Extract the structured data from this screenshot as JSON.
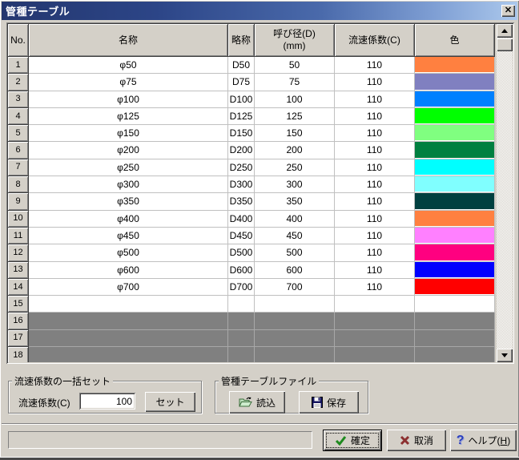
{
  "window": {
    "title": "管種テーブル"
  },
  "titlebar": {
    "gradient_left": "#24376f",
    "gradient_right": "#abc8ec"
  },
  "table": {
    "headers": {
      "no": "No.",
      "name": "名称",
      "abbr": "略称",
      "diameter_line1": "呼び径(D)",
      "diameter_line2": "(mm)",
      "coeff": "流速係数(C)",
      "color": "色"
    },
    "rows": [
      {
        "no": "1",
        "name": "φ50",
        "abbr": "D50",
        "diameter": "50",
        "coeff": "110",
        "color": "#FF8040",
        "state": "data"
      },
      {
        "no": "2",
        "name": "φ75",
        "abbr": "D75",
        "diameter": "75",
        "coeff": "110",
        "color": "#8080C0",
        "state": "data"
      },
      {
        "no": "3",
        "name": "φ100",
        "abbr": "D100",
        "diameter": "100",
        "coeff": "110",
        "color": "#0080FF",
        "state": "data"
      },
      {
        "no": "4",
        "name": "φ125",
        "abbr": "D125",
        "diameter": "125",
        "coeff": "110",
        "color": "#00FF00",
        "state": "data"
      },
      {
        "no": "5",
        "name": "φ150",
        "abbr": "D150",
        "diameter": "150",
        "coeff": "110",
        "color": "#80FF80",
        "state": "data"
      },
      {
        "no": "6",
        "name": "φ200",
        "abbr": "D200",
        "diameter": "200",
        "coeff": "110",
        "color": "#008040",
        "state": "data"
      },
      {
        "no": "7",
        "name": "φ250",
        "abbr": "D250",
        "diameter": "250",
        "coeff": "110",
        "color": "#00FFFF",
        "state": "data"
      },
      {
        "no": "8",
        "name": "φ300",
        "abbr": "D300",
        "diameter": "300",
        "coeff": "110",
        "color": "#80FFFF",
        "state": "data"
      },
      {
        "no": "9",
        "name": "φ350",
        "abbr": "D350",
        "diameter": "350",
        "coeff": "110",
        "color": "#004040",
        "state": "data"
      },
      {
        "no": "10",
        "name": "φ400",
        "abbr": "D400",
        "diameter": "400",
        "coeff": "110",
        "color": "#FF8040",
        "state": "data"
      },
      {
        "no": "11",
        "name": "φ450",
        "abbr": "D450",
        "diameter": "450",
        "coeff": "110",
        "color": "#FF80FF",
        "state": "data"
      },
      {
        "no": "12",
        "name": "φ500",
        "abbr": "D500",
        "diameter": "500",
        "coeff": "110",
        "color": "#FF0080",
        "state": "data"
      },
      {
        "no": "13",
        "name": "φ600",
        "abbr": "D600",
        "diameter": "600",
        "coeff": "110",
        "color": "#0000FF",
        "state": "data"
      },
      {
        "no": "14",
        "name": "φ700",
        "abbr": "D700",
        "diameter": "700",
        "coeff": "110",
        "color": "#FF0000",
        "state": "data"
      },
      {
        "no": "15",
        "name": "",
        "abbr": "",
        "diameter": "",
        "coeff": "",
        "color": null,
        "state": "empty"
      },
      {
        "no": "16",
        "name": "",
        "abbr": "",
        "diameter": "",
        "coeff": "",
        "color": null,
        "state": "disabled"
      },
      {
        "no": "17",
        "name": "",
        "abbr": "",
        "diameter": "",
        "coeff": "",
        "color": null,
        "state": "disabled"
      },
      {
        "no": "18",
        "name": "",
        "abbr": "",
        "diameter": "",
        "coeff": "",
        "color": null,
        "state": "disabled"
      }
    ],
    "disabled_row_color": "#808080"
  },
  "coeff_group": {
    "title": "流速係数の一括セット",
    "label": "流速係数(C)",
    "value": "100",
    "set_button": "セット"
  },
  "file_group": {
    "title": "管種テーブルファイル",
    "load_button": "読込",
    "save_button": "保存"
  },
  "footer": {
    "ok": "確定",
    "cancel": "取消",
    "help_prefix": "ヘルプ(",
    "help_key": "H",
    "help_suffix": ")"
  },
  "icon_colors": {
    "ok_check": "#1e8a1e",
    "cancel_x": "#8c3030",
    "help_qmark": "#2b3fbf",
    "folder": "#b8dcb8",
    "floppy": "#14145e"
  }
}
